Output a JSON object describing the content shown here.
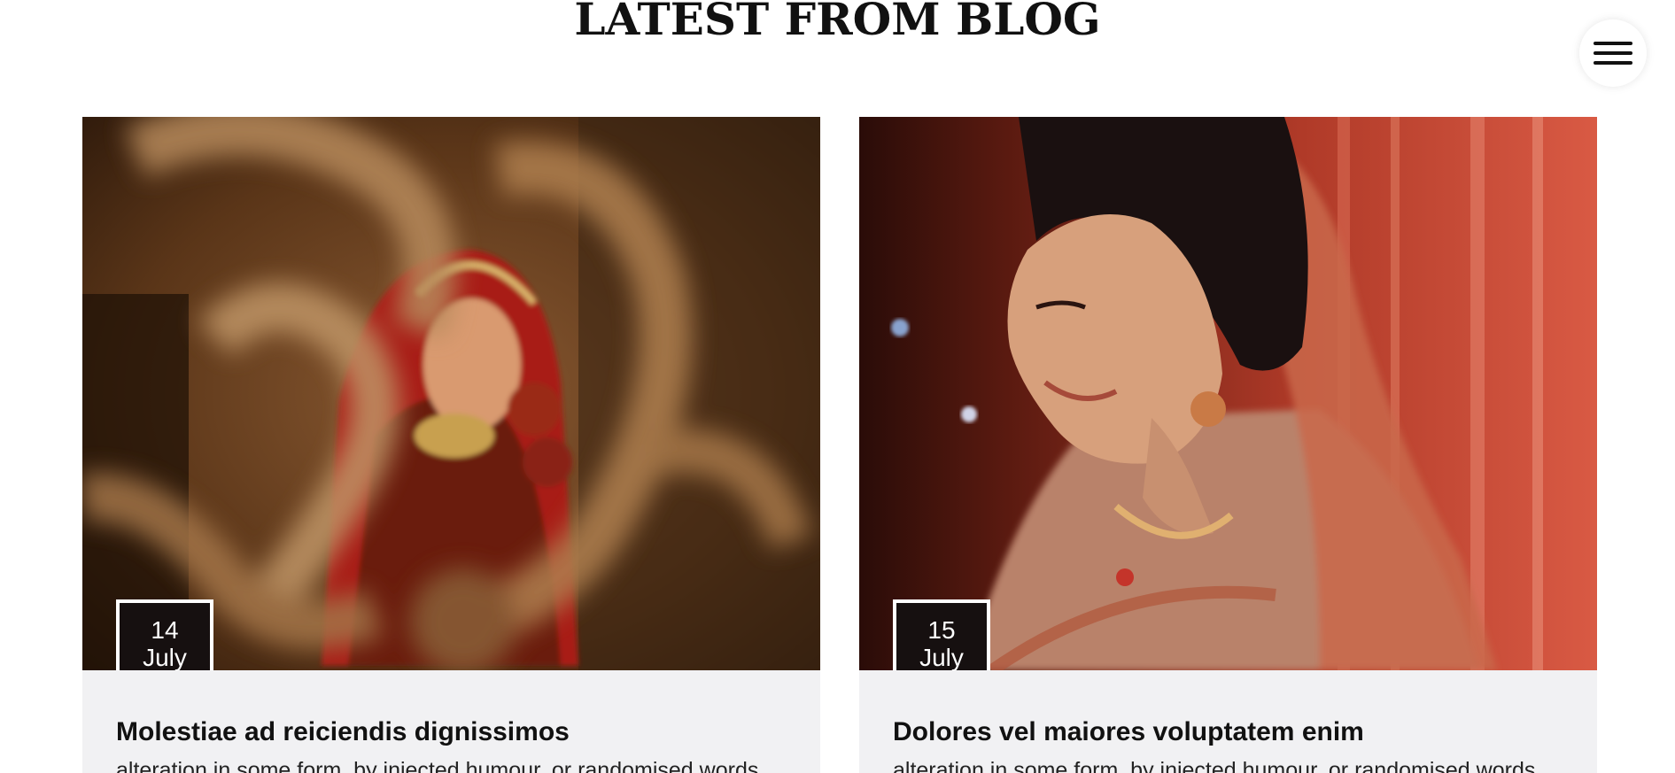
{
  "section": {
    "title": "LATEST FROM BLOG"
  },
  "menu": {
    "icon": "hamburger-menu-icon"
  },
  "posts": [
    {
      "day": "14",
      "month": "July",
      "title": "Molestiae ad reiciendis dignissimos",
      "excerpt": "alteration in some form, by injected humour, or randomised words"
    },
    {
      "day": "15",
      "month": "July",
      "title": "Dolores vel maiores voluptatem enim",
      "excerpt": "alteration in some form, by injected humour, or randomised words"
    }
  ],
  "colors": {
    "badge_bg": "#161010",
    "card_bg": "#f1f1f3",
    "text": "#111111"
  }
}
